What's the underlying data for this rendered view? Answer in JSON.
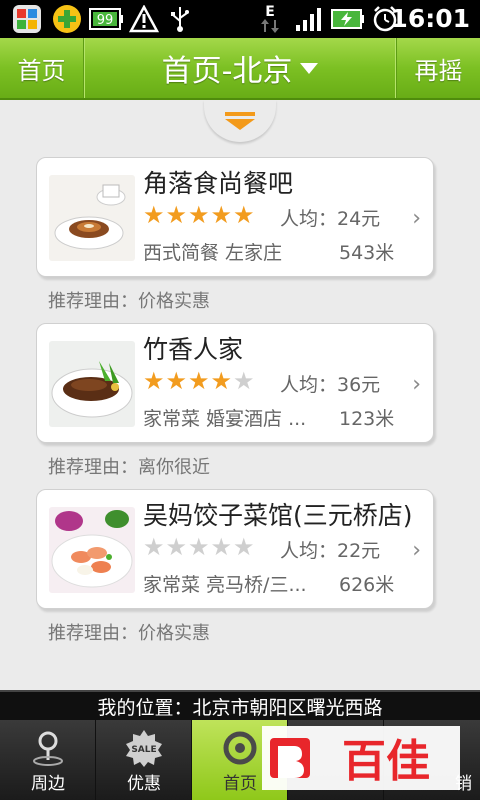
{
  "status_bar": {
    "time": "16:01",
    "battery_badge": "99",
    "network_type": "E",
    "icons": [
      "app-store-icon",
      "plus-icon",
      "battery-99-icon",
      "warning-icon",
      "usb-icon",
      "network-icon",
      "signal-icon",
      "battery-charging-icon",
      "alarm-icon"
    ]
  },
  "header": {
    "left_label": "首页",
    "title": "首页-北京",
    "right_label": "再摇"
  },
  "restaurants": [
    {
      "name": "角落食尚餐吧",
      "rating": 5,
      "price": "人均：24元",
      "category": "西式简餐 左家庄",
      "distance": "543米",
      "reason": "推荐理由：价格实惠",
      "thumb": "dessert-plate-image"
    },
    {
      "name": "竹香人家",
      "rating": 4,
      "price": "人均：36元",
      "category": "家常菜 婚宴酒店 ...",
      "distance": "123米",
      "reason": "推荐理由：离你很近",
      "thumb": "steak-dish-image"
    },
    {
      "name": "吴妈饺子菜馆(三元桥店)",
      "rating": 0,
      "price": "人均：22元",
      "category": "家常菜 亮马桥/三...",
      "distance": "626米",
      "reason": "推荐理由：价格实惠",
      "thumb": "shrimp-dish-image"
    }
  ],
  "location": "我的位置：北京市朝阳区曙光西路",
  "tabs": [
    {
      "label": "周边",
      "icon": "nearby-pin-icon"
    },
    {
      "label": "优惠",
      "icon": "sale-badge-icon"
    },
    {
      "label": "首页",
      "icon": "shake-icon"
    },
    {
      "label": "",
      "icon": ""
    },
    {
      "label": "销",
      "icon": ""
    }
  ],
  "watermark": "百佳",
  "colors": {
    "header_green": "#7cc023",
    "star_orange": "#f29c1f",
    "accent_orange": "#f39a1a",
    "watermark_red": "#e8262b"
  }
}
